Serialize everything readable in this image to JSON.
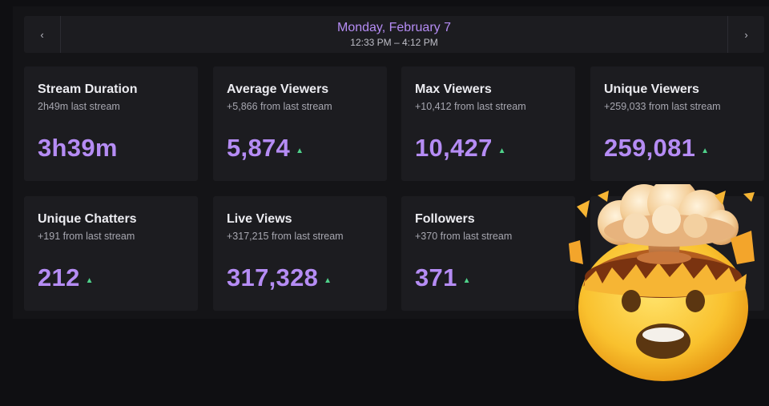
{
  "header": {
    "date": "Monday, February 7",
    "time_range": "12:33 PM – 4:12 PM",
    "prev_icon": "chevron-left-icon",
    "next_icon": "chevron-right-icon"
  },
  "stats": [
    {
      "title": "Stream Duration",
      "sub": "2h49m last stream",
      "value": "3h39m",
      "trend": ""
    },
    {
      "title": "Average Viewers",
      "sub": "+5,866 from last stream",
      "value": "5,874",
      "trend": "up"
    },
    {
      "title": "Max Viewers",
      "sub": "+10,412 from last stream",
      "value": "10,427",
      "trend": "up"
    },
    {
      "title": "Unique Viewers",
      "sub": "+259,033 from last stream",
      "value": "259,081",
      "trend": "up"
    },
    {
      "title": "Unique Chatters",
      "sub": "+191 from last stream",
      "value": "212",
      "trend": "up"
    },
    {
      "title": "Live Views",
      "sub": "+317,215 from last stream",
      "value": "317,328",
      "trend": "up"
    },
    {
      "title": "Followers",
      "sub": "+370 from last stream",
      "value": "371",
      "trend": "up"
    }
  ],
  "overlay": {
    "emoji": "exploding-head-emoji"
  },
  "colors": {
    "accent": "#b58cf4",
    "trend_up": "#4fd28a",
    "card_bg": "#1c1c20",
    "page_bg": "#0f0f12"
  }
}
